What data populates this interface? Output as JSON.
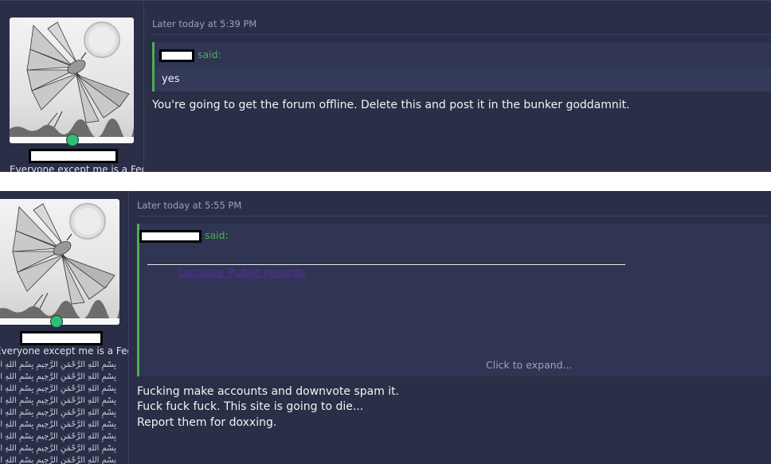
{
  "posts": [
    {
      "user": {
        "title": "Everyone except me is a Fed"
      },
      "date": "Later today at 5:39 PM",
      "quote": {
        "said": "said:",
        "text": "yes"
      },
      "message": [
        "You're going to get the forum offline. Delete this and post it in the bunker goddamnit."
      ]
    },
    {
      "user": {
        "title": "Everyone except me is a Fed",
        "signature_lines": [
          "بِسْمِ اللهِ الرَّحْمَنِ الرَّحِيمِ بِسْمِ اللهِ الرَّحْمَنِ الرَّحِيمِ",
          "بِسْمِ اللهِ الرَّحْمَنِ الرَّحِيمِ بِسْمِ اللهِ الرَّحْمَنِ الرَّحِيمِ",
          "بِسْمِ اللهِ الرَّحْمَنِ الرَّحِيمِ بِسْمِ اللهِ الرَّحْمَنِ الرَّحِيمِ",
          "بِسْمِ اللهِ الرَّحْمَنِ الرَّحِيمِ بِسْمِ اللهِ الرَّحْمَنِ الرَّحِيمِ",
          "بِسْمِ اللهِ الرَّحْمَنِ الرَّحِيمِ بِسْمِ اللهِ الرَّحْمَنِ الرَّحِيمِ",
          "بِسْمِ اللهِ الرَّحْمَنِ الرَّحِيمِ بِسْمِ اللهِ الرَّحْمَنِ الرَّحِيمِ",
          "بِسْمِ اللهِ الرَّحْمَنِ الرَّحِيمِ بِسْمِ اللهِ الرَّحْمَنِ الرَّحِيمِ",
          "بِسْمِ اللهِ الرَّحْمَنِ الرَّحِيمِ بِسْمِ اللهِ الرَّحْمَنِ الرَّحِيمِ",
          "بِسْمِ اللهِ الرَّحْمَنِ الرَّحِيمِ بِسْمِ اللهِ الرَّحْمَنِ الرَّحِيمِ"
        ]
      },
      "date": "Later today at 5:55 PM",
      "quote": {
        "said": "said:",
        "link_text": "Localize Public records",
        "expand": "Click to expand..."
      },
      "message": [
        "Fucking make accounts and downvote spam it.",
        "Fuck fuck fuck. This site is going to die...",
        "Report them for doxxing."
      ]
    }
  ],
  "colors": {
    "post_bg": "#2a2f47",
    "quote_border": "#4caf50",
    "online": "#2fbf71",
    "link": "#5b2ea8"
  },
  "icons": [
    "avatar-crane-moon",
    "online-status-dot"
  ]
}
